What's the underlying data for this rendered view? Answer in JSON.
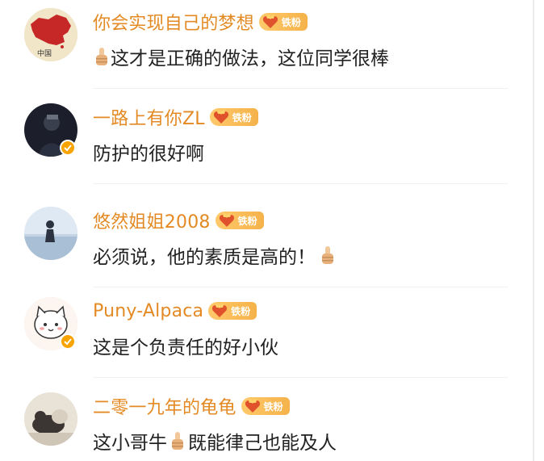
{
  "colors": {
    "username": "#e38a24",
    "text": "#222222",
    "badge": "#f5b24a",
    "verified": "#f7a300"
  },
  "comments": [
    {
      "username": "你会实现自己的梦想",
      "badge": "铁粉",
      "text": "这才是正确的做法，这位同学很棒",
      "emoji_pos": "start",
      "avatar": {
        "kind": "china-map",
        "verified": false,
        "caption": "中国"
      }
    },
    {
      "username": "一路上有你ZL",
      "badge": "铁粉",
      "text": "防护的很好啊",
      "avatar": {
        "kind": "person-dark",
        "verified": true
      }
    },
    {
      "username": "悠然姐姐2008",
      "badge": "铁粉",
      "text": "必须说，他的素质是高的！",
      "emoji_pos": "end",
      "avatar": {
        "kind": "sea-figure",
        "verified": false
      }
    },
    {
      "username": "Puny-Alpaca",
      "badge": "铁粉",
      "text": "这是个负责任的好小伙",
      "avatar": {
        "kind": "cartoon-cat",
        "verified": true
      }
    },
    {
      "username": "二零一九年的龟龟",
      "badge": "铁粉",
      "text_before": "这小哥牛",
      "text_after": "既能律己也能及人",
      "avatar": {
        "kind": "cat-photo",
        "verified": false
      }
    }
  ]
}
